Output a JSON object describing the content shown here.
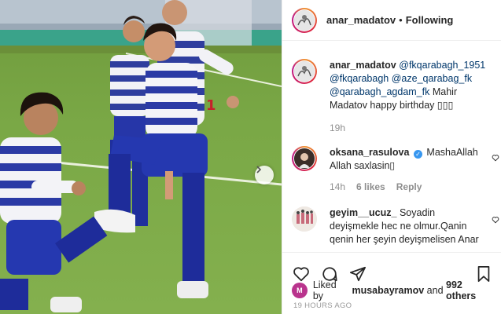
{
  "post": {
    "username": "anar_madatov",
    "separator": "•",
    "follow_state": "Following"
  },
  "caption": {
    "author": "anar_madatov",
    "mentions": [
      "@fkqarabagh_1951",
      "@fkqarabagh",
      "@aze_qarabag_fk",
      "@qarabagh_agdam_fk"
    ],
    "text": "Mahir Madatov happy birthday ▯▯▯",
    "time": "19h"
  },
  "comments": [
    {
      "author": "oksana_rasulova",
      "verified": true,
      "text": "MashaAllah Allah saxlasin▯",
      "time": "14h",
      "likes": "6 likes",
      "reply": "Reply"
    },
    {
      "author": "geyim__ucuz_",
      "text": "Soyadin deyişmekle hec ne olmur.Qanin qenin her şeyin deyişmelisen Anar",
      "time": ""
    }
  ],
  "likes": {
    "prefix": "Liked by",
    "first_user": "musabayramov",
    "connector": "and",
    "others": "992 others"
  },
  "timestamp": "19 HOURS AGO",
  "icons": [
    "heart-icon",
    "comment-icon",
    "share-icon",
    "bookmark-icon",
    "next-arrow-icon"
  ]
}
